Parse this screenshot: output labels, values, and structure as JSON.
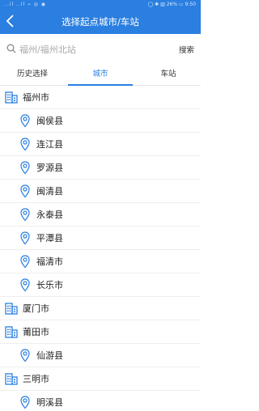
{
  "status_bar": {
    "left": "..il ..il ⌁ ◎ ◉",
    "right": "◯ ✱ ▥ 26% ▭ 9:50"
  },
  "header": {
    "title": "选择起点城市/车站"
  },
  "search": {
    "placeholder": "福州/福州北站",
    "button_label": "搜索"
  },
  "tabs": [
    {
      "label": "历史选择"
    },
    {
      "label": "城市"
    },
    {
      "label": "车站"
    }
  ],
  "colors": {
    "accent": "#2a7fe0",
    "header_bg": "#2a7fe0"
  },
  "list": [
    {
      "kind": "city",
      "label": "福州市",
      "icon": "building-icon"
    },
    {
      "kind": "county",
      "label": "闽侯县",
      "icon": "location-pin-icon"
    },
    {
      "kind": "county",
      "label": "连江县",
      "icon": "location-pin-icon"
    },
    {
      "kind": "county",
      "label": "罗源县",
      "icon": "location-pin-icon"
    },
    {
      "kind": "county",
      "label": "闽清县",
      "icon": "location-pin-icon"
    },
    {
      "kind": "county",
      "label": "永泰县",
      "icon": "location-pin-icon"
    },
    {
      "kind": "county",
      "label": "平潭县",
      "icon": "location-pin-icon"
    },
    {
      "kind": "county",
      "label": "福清市",
      "icon": "location-pin-icon"
    },
    {
      "kind": "county",
      "label": "长乐市",
      "icon": "location-pin-icon"
    },
    {
      "kind": "city",
      "label": "厦门市",
      "icon": "building-icon"
    },
    {
      "kind": "city",
      "label": "莆田市",
      "icon": "building-icon"
    },
    {
      "kind": "county",
      "label": "仙游县",
      "icon": "location-pin-icon"
    },
    {
      "kind": "city",
      "label": "三明市",
      "icon": "building-icon"
    },
    {
      "kind": "county",
      "label": "明溪县",
      "icon": "location-pin-icon"
    }
  ]
}
